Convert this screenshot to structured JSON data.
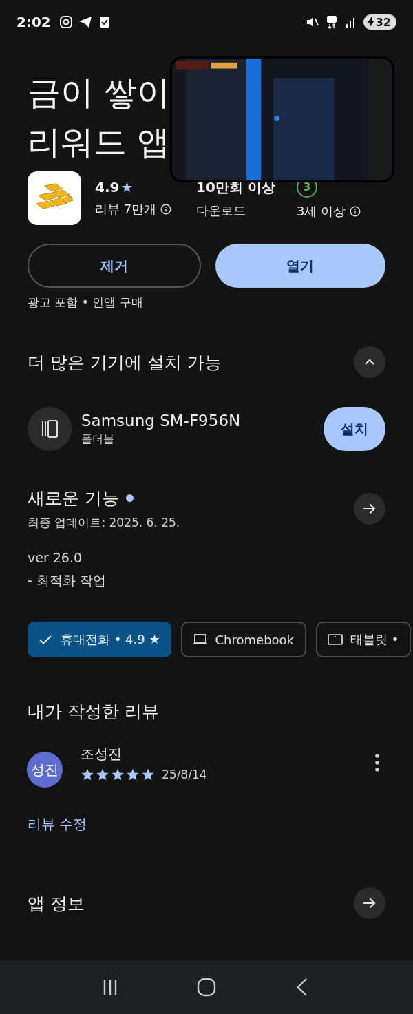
{
  "status_bar": {
    "time": "2:02",
    "battery": "32"
  },
  "app": {
    "title_lines": [
      "금이 쌓이",
      "리워드 앱"
    ],
    "rating": "4.9",
    "rating_star": "★",
    "reviews": "리뷰 7만개",
    "downloads": "10만회 이상",
    "downloads_label": "다운로드",
    "age_badge": "3",
    "age": "3세 이상"
  },
  "buttons": [
    {
      "label": "제거",
      "kind": "outline"
    },
    {
      "label": "열기",
      "kind": "filled"
    }
  ],
  "notice": "광고 포함 • 인앱 구매",
  "devices_section": {
    "title": "더 많은 기기에 설치 가능",
    "expanded": true,
    "device": {
      "name": "Samsung SM-F956N",
      "type": "폴더블",
      "button": "설치"
    }
  },
  "whats_new": {
    "title": "새로운 기능",
    "new": true,
    "updated": "최종 업데이트: 2025. 6. 25.",
    "notes": [
      "ver 26.0",
      "- 최적화 작업"
    ]
  },
  "device_tabs": [
    {
      "label": "휴대전화 • 4.9 ★",
      "kind": "phone",
      "selected": true
    },
    {
      "label": "Chromebook",
      "kind": "laptop",
      "selected": false
    },
    {
      "label": "태블릿 •",
      "kind": "tablet",
      "selected": false
    }
  ],
  "my_review": {
    "title": "내가 작성한 리뷰",
    "avatar": "성진",
    "name": "조성진",
    "stars": 5,
    "date": "25/8/14",
    "edit_link": "리뷰 수정"
  },
  "app_info": {
    "title": "앱 정보"
  }
}
